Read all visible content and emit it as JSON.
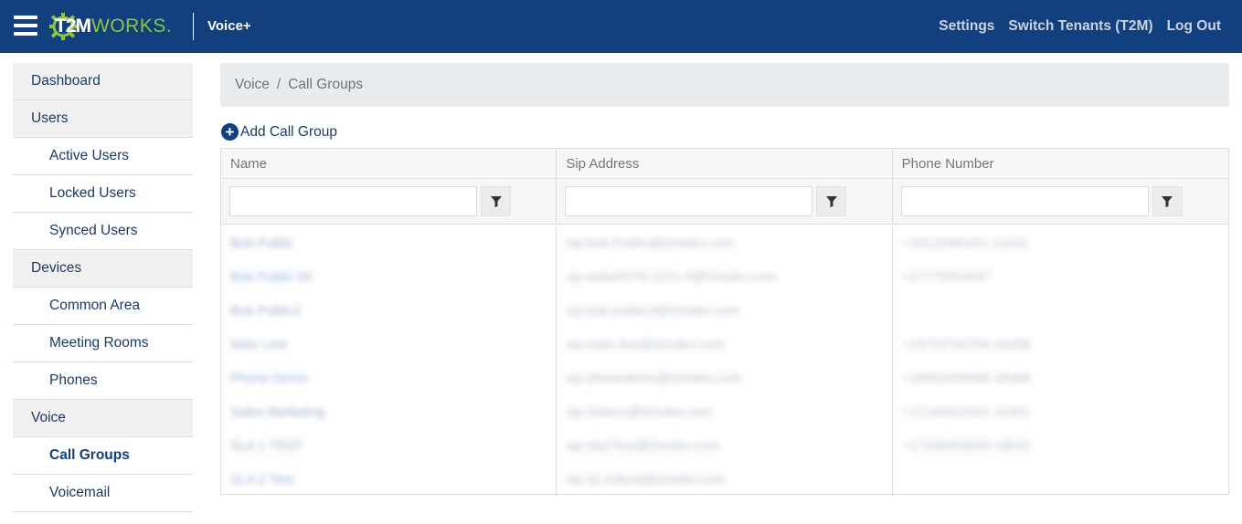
{
  "header": {
    "logo_t2m": "T2M",
    "logo_works": "WORKS.",
    "app_name": "Voice+",
    "nav": [
      "Settings",
      "Switch Tenants (T2M)",
      "Log Out"
    ],
    "brand_color": "#123f7e",
    "accent_color": "#8cc63f"
  },
  "sidebar": {
    "items": [
      {
        "label": "Dashboard",
        "type": "section"
      },
      {
        "label": "Users",
        "type": "section"
      },
      {
        "label": "Active Users",
        "type": "sub"
      },
      {
        "label": "Locked Users",
        "type": "sub"
      },
      {
        "label": "Synced Users",
        "type": "sub"
      },
      {
        "label": "Devices",
        "type": "section"
      },
      {
        "label": "Common Area",
        "type": "sub"
      },
      {
        "label": "Meeting Rooms",
        "type": "sub"
      },
      {
        "label": "Phones",
        "type": "sub"
      },
      {
        "label": "Voice",
        "type": "section"
      },
      {
        "label": "Call Groups",
        "type": "sub",
        "active": true
      },
      {
        "label": "Voicemail",
        "type": "sub"
      }
    ]
  },
  "breadcrumb": {
    "parent": "Voice",
    "separator": "/",
    "current": "Call Groups"
  },
  "add_button": {
    "icon": "plus-circle-icon",
    "label": "Add Call Group"
  },
  "table": {
    "columns": [
      "Name",
      "Sip Address",
      "Phone Number"
    ],
    "filter_icon": "filter-icon",
    "rows": [
      {
        "name": "Bob Public",
        "sip": "sip:bob.Public@t2mdev.com",
        "phone": "+16122481151 x1151"
      },
      {
        "name": "Bob Public 99",
        "sip": "sip:ewke9379-157c-4@t2mdev.com",
        "phone": "+17775554447"
      },
      {
        "name": "Bob Public2",
        "sip": "sip:bob.public2@t2mdev.com",
        "phone": ""
      },
      {
        "name": "Main Line",
        "sip": "sip:main.line@t2mdev.com",
        "phone": "+19724792256 x5258"
      },
      {
        "name": "Phone Demo",
        "sip": "sip:phonedemo@t2mdev.com",
        "phone": "+18452059368 x9368"
      },
      {
        "name": "Sales Marketing",
        "sip": "sip:Sales1@t2mdev.com",
        "phone": "+12149321501 x1501"
      },
      {
        "name": "SLA 1 TEST",
        "sip": "sip:sla1Test@t2mdev.com",
        "phone": "+17206059633 x9633"
      },
      {
        "name": "SLA 2 Test",
        "sip": "sip:SLA2test@t2mdev.com",
        "phone": ""
      }
    ]
  }
}
